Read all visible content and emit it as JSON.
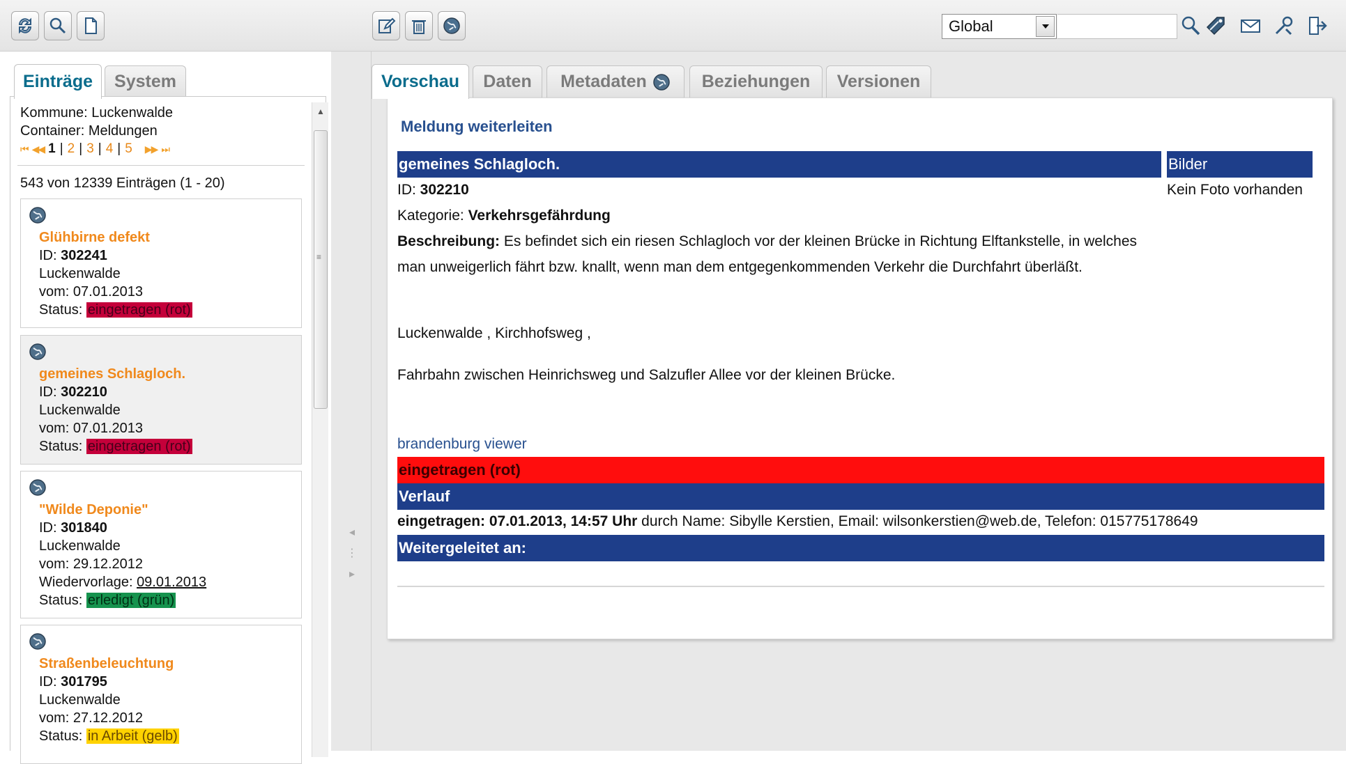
{
  "toolbar": {
    "left_buttons": [
      "refresh-icon",
      "search-icon",
      "new-document-icon"
    ],
    "mid_buttons": [
      "edit-icon",
      "delete-icon",
      "globe-icon"
    ],
    "scope_value": "Global",
    "search_placeholder": "",
    "right_icons": [
      "search-icon",
      "tag-icon",
      "mail-icon",
      "tools-icon",
      "logout-icon"
    ]
  },
  "left_tabs": [
    {
      "label": "Einträge",
      "active": true
    },
    {
      "label": "System",
      "active": false
    }
  ],
  "left_panel": {
    "kommune": "Kommune: Luckenwalde",
    "container": "Container: Meldungen",
    "pager": {
      "first": "⏮",
      "prev": "◀◀",
      "current": "1",
      "pages": [
        "2",
        "3",
        "4",
        "5"
      ],
      "next": "▶▶",
      "last": "⏭"
    },
    "count": "543 von 12339 Einträgen (1 - 20)",
    "entries": [
      {
        "title": "Glühbirne defekt",
        "id_label": "ID: ",
        "id": "302241",
        "city": "Luckenwalde",
        "date": "vom: 07.01.2013",
        "status_label": "Status: ",
        "status": "eingetragen (rot)"
      },
      {
        "title": "gemeines Schlagloch.",
        "id_label": "ID: ",
        "id": "302210",
        "city": "Luckenwalde",
        "date": "vom: 07.01.2013",
        "status_label": "Status: ",
        "status": "eingetragen (rot)"
      },
      {
        "title": "\"Wilde Deponie\"",
        "id_label": "ID: ",
        "id": "301840",
        "city": "Luckenwalde",
        "date": "vom: 29.12.2012",
        "followup_label": "Wiedervorlage: ",
        "followup": "09.01.2013",
        "status_label": "Status: ",
        "status": "erledigt (grün)"
      },
      {
        "title": "Straßenbeleuchtung",
        "id_label": "ID: ",
        "id": "301795",
        "city": "Luckenwalde",
        "date": "vom: 27.12.2012",
        "status_label": "Status: ",
        "status": "in Arbeit (gelb)"
      }
    ]
  },
  "right_tabs": [
    {
      "label": "Vorschau",
      "active": true
    },
    {
      "label": "Daten",
      "active": false
    },
    {
      "label": "Metadaten",
      "active": false
    },
    {
      "label": "Beziehungen",
      "active": false
    },
    {
      "label": "Versionen",
      "active": false
    }
  ],
  "detail": {
    "action_title": "Meldung weiterleiten",
    "report_title": "gemeines Schlagloch.",
    "images_header": "Bilder",
    "images_text": "Kein Foto vorhanden",
    "id_label": "ID: ",
    "id": "302210",
    "category_label": "Kategorie: ",
    "category": "Verkehrsgefährdung",
    "description_label": "Beschreibung:",
    "description": " Es befindet sich ein riesen Schlagloch vor der kleinen Brücke in Richtung Elftankstelle, in welches man unweigerlich fährt bzw. knallt, wenn man dem entgegenkommenden Verkehr die Durchfahrt überläßt.",
    "address": "Luckenwalde , Kirchhofsweg ,",
    "location": "Fahrbahn zwischen Heinrichsweg und Salzufler Allee vor der kleinen Brücke.",
    "viewer_link": "brandenburg viewer",
    "status_bar": "eingetragen (rot)",
    "history_header": "Verlauf",
    "history_entry_bold": "eingetragen: 07.01.2013, 14:57 Uhr",
    "history_entry_rest": " durch Name: Sibylle Kerstien, Email: wilsonkerstien@web.de, Telefon: 015775178649",
    "forwarded_header": "Weitergeleitet an:"
  },
  "colors": {
    "accent_orange": "#f0891c",
    "header_blue": "#1e3e8a",
    "status_red": "#c4003a",
    "status_green": "#16934e",
    "status_yellow": "#ffd200"
  }
}
